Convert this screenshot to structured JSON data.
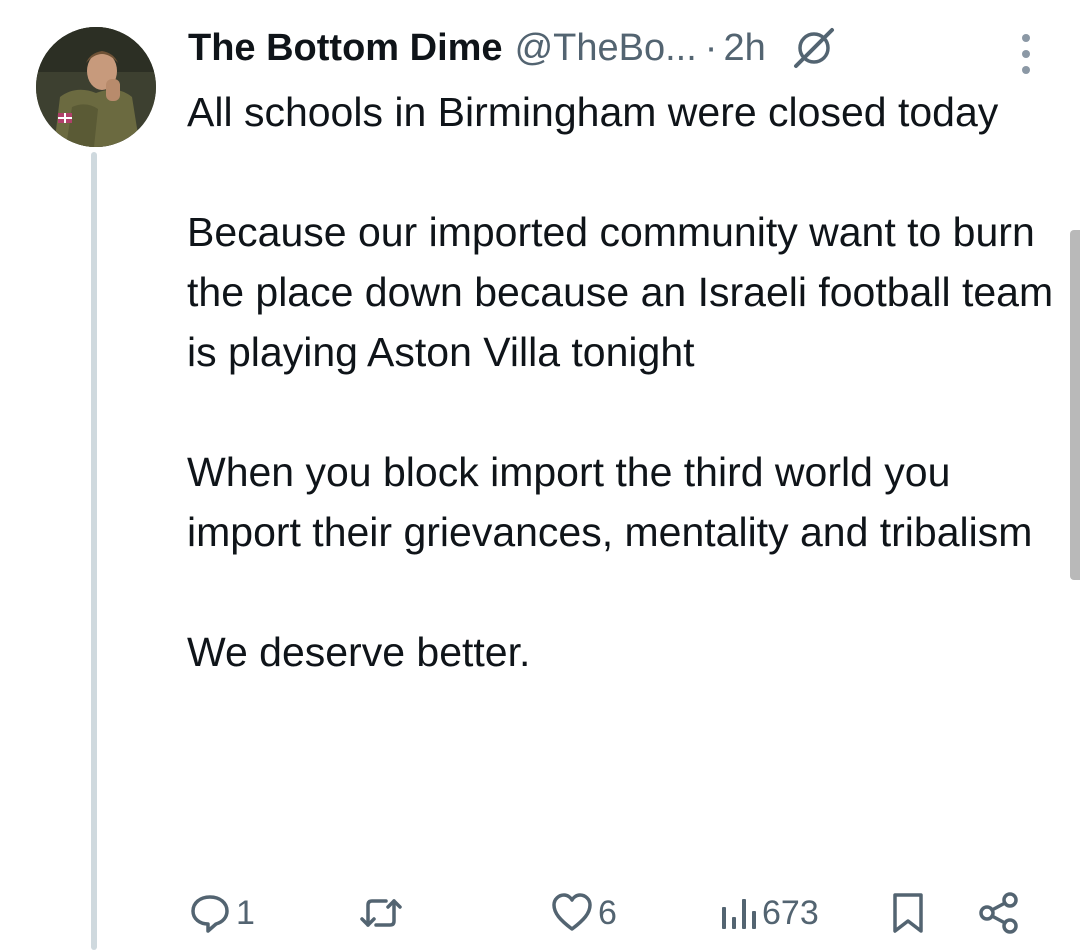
{
  "tweet": {
    "display_name": "The Bottom Dime",
    "handle": "@TheBo...",
    "separator": "·",
    "time": "2h",
    "paragraphs": [
      "All schools in Birmingham were closed today",
      "Because our imported community want to burn the place down because an Israeli football team is playing Aston Villa tonight",
      "When you block import the third world you import their grievances, mentality and tribalism",
      "We deserve better."
    ]
  },
  "actions": {
    "reply_count": "1",
    "repost_count": "",
    "like_count": "6",
    "views_count": "673"
  },
  "icons": {
    "header": [
      "grok-icon",
      "more-vertical-icon"
    ],
    "actions": [
      "reply-icon",
      "repost-icon",
      "like-icon",
      "views-icon",
      "bookmark-icon",
      "share-icon"
    ]
  },
  "colors": {
    "text_primary": "#0f1419",
    "text_secondary": "#536471",
    "thread_line": "#cfd9de",
    "background": "#ffffff"
  }
}
